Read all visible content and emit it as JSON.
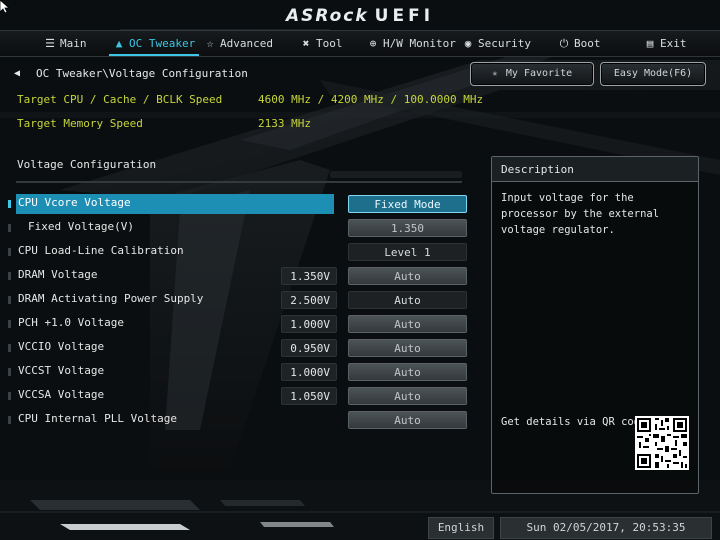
{
  "header": {
    "brand": "ASRock",
    "product": "UEFI"
  },
  "tabs": [
    {
      "label": "Main",
      "icon": "list-icon",
      "active": false
    },
    {
      "label": "OC Tweaker",
      "icon": "droplet-icon",
      "active": true
    },
    {
      "label": "Advanced",
      "icon": "star-icon",
      "active": false
    },
    {
      "label": "Tool",
      "icon": "tools-icon",
      "active": false
    },
    {
      "label": "H/W Monitor",
      "icon": "monitor-icon",
      "active": false
    },
    {
      "label": "Security",
      "icon": "shield-icon",
      "active": false
    },
    {
      "label": "Boot",
      "icon": "power-icon",
      "active": false
    },
    {
      "label": "Exit",
      "icon": "exit-icon",
      "active": false
    }
  ],
  "breadcrumb": "OC Tweaker\\Voltage Configuration",
  "buttons": {
    "favorite": "My Favorite",
    "easy_mode": "Easy Mode(F6)"
  },
  "info": [
    {
      "label": "Target CPU / Cache / BCLK Speed",
      "value": "4600 MHz / 4200 MHz / 100.0000 MHz"
    },
    {
      "label": "Target Memory Speed",
      "value": "2133 MHz"
    }
  ],
  "section_title": "Voltage Configuration",
  "settings": [
    {
      "label": "CPU Vcore Voltage",
      "value": "",
      "option": "Fixed Mode",
      "selected": true,
      "style": "blue"
    },
    {
      "label": "Fixed Voltage(V)",
      "value": "",
      "option": "1.350",
      "selected": false,
      "style": "grey",
      "indent": true
    },
    {
      "label": "CPU Load-Line Calibration",
      "value": "",
      "option": "Level 1",
      "selected": false,
      "style": "dark"
    },
    {
      "label": "DRAM Voltage",
      "value": "1.350V",
      "option": "Auto",
      "selected": false,
      "style": "grey"
    },
    {
      "label": "DRAM Activating Power Supply",
      "value": "2.500V",
      "option": "Auto",
      "selected": false,
      "style": "dark"
    },
    {
      "label": "PCH +1.0 Voltage",
      "value": "1.000V",
      "option": "Auto",
      "selected": false,
      "style": "grey"
    },
    {
      "label": "VCCIO Voltage",
      "value": "0.950V",
      "option": "Auto",
      "selected": false,
      "style": "grey"
    },
    {
      "label": "VCCST Voltage",
      "value": "1.000V",
      "option": "Auto",
      "selected": false,
      "style": "grey"
    },
    {
      "label": "VCCSA Voltage",
      "value": "1.050V",
      "option": "Auto",
      "selected": false,
      "style": "grey"
    },
    {
      "label": "CPU Internal PLL Voltage",
      "value": "",
      "option": "Auto",
      "selected": false,
      "style": "grey"
    }
  ],
  "description": {
    "title": "Description",
    "text": "Input voltage for the processor by the external voltage regulator.",
    "qr_label": "Get details via QR code"
  },
  "footer": {
    "language": "English",
    "datetime": "Sun 02/05/2017, 20:53:35"
  },
  "colors": {
    "accent": "#3ec6e6",
    "info_text": "#c7d63a",
    "selected_row": "#1d8fb5"
  }
}
